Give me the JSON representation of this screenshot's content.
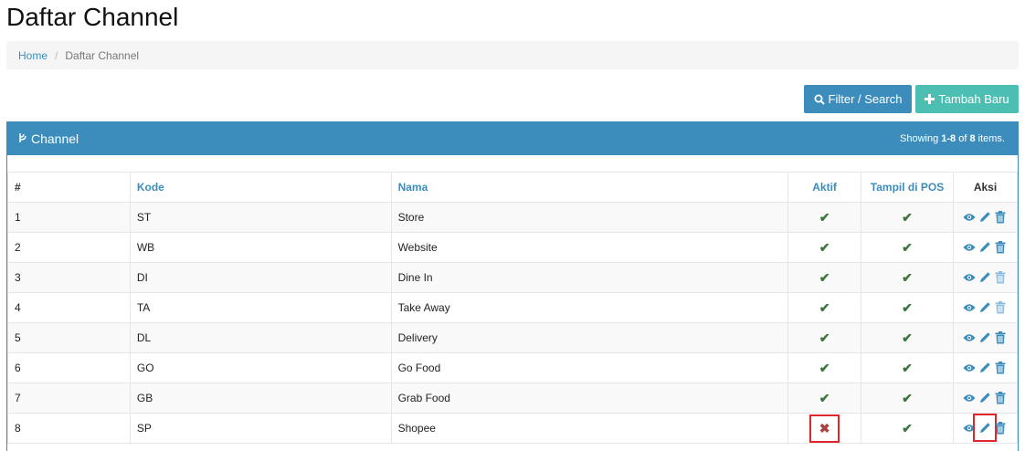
{
  "page": {
    "title": "Daftar Channel"
  },
  "breadcrumb": {
    "home": "Home",
    "separator": "/",
    "current": "Daftar Channel"
  },
  "toolbar": {
    "filter_label": "Filter / Search",
    "add_label": "Tambah Baru"
  },
  "panel": {
    "title": "Channel",
    "summary_prefix": "Showing ",
    "summary_range": "1-8",
    "summary_of": " of ",
    "summary_total": "8",
    "summary_suffix": " items."
  },
  "table": {
    "headers": [
      "#",
      "Kode",
      "Nama",
      "Aktif",
      "Tampil di POS",
      "Aksi"
    ],
    "rows": [
      {
        "no": "1",
        "kode": "ST",
        "nama": "Store",
        "aktif": true,
        "pos": true
      },
      {
        "no": "2",
        "kode": "WB",
        "nama": "Website",
        "aktif": true,
        "pos": true
      },
      {
        "no": "3",
        "kode": "DI",
        "nama": "Dine In",
        "aktif": true,
        "pos": true
      },
      {
        "no": "4",
        "kode": "TA",
        "nama": "Take Away",
        "aktif": true,
        "pos": true
      },
      {
        "no": "5",
        "kode": "DL",
        "nama": "Delivery",
        "aktif": true,
        "pos": true
      },
      {
        "no": "6",
        "kode": "GO",
        "nama": "Go Food",
        "aktif": true,
        "pos": true
      },
      {
        "no": "7",
        "kode": "GB",
        "nama": "Grab Food",
        "aktif": true,
        "pos": true
      },
      {
        "no": "8",
        "kode": "SP",
        "nama": "Shopee",
        "aktif": false,
        "pos": true
      }
    ]
  },
  "icons": {
    "view": "eye-icon",
    "edit": "pencil-icon",
    "delete": "trash-icon"
  },
  "colors": {
    "primary": "#3c8dbc",
    "success_button": "#4cbfb2",
    "check": "#3c763d",
    "cross": "#a94442",
    "highlight": "#e0252b"
  }
}
